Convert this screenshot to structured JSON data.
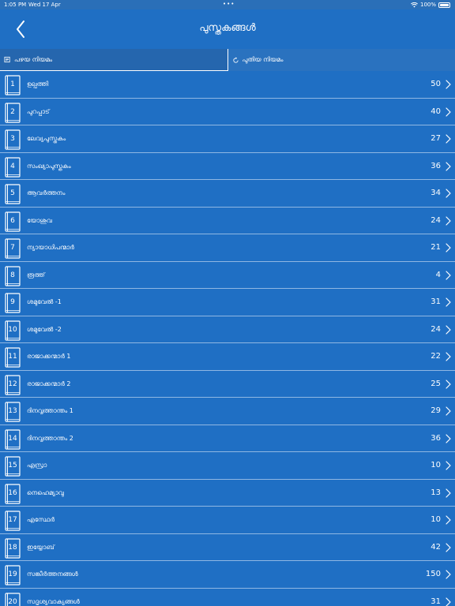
{
  "status": {
    "time": "1:05 PM",
    "date": "Wed 17 Apr",
    "dots": "•••",
    "battery": "100%"
  },
  "nav": {
    "title": "പുസ്തകങ്ങൾ",
    "back_icon": "chevron-left-icon"
  },
  "tabs": [
    {
      "label": "പഴയ നിയമം",
      "icon": "scroll-icon"
    },
    {
      "label": "പുതിയ നിയമം",
      "icon": "refresh-icon"
    }
  ],
  "books": [
    {
      "number": "1",
      "name": "ഉല്പത്തി",
      "chapters": "50"
    },
    {
      "number": "2",
      "name": "പുറപ്പാട്",
      "chapters": "40"
    },
    {
      "number": "3",
      "name": "ലേവ്യപുസ്തകം",
      "chapters": "27"
    },
    {
      "number": "4",
      "name": "സംഖ്യാപുസ്തകം",
      "chapters": "36"
    },
    {
      "number": "5",
      "name": "ആവർത്തനം",
      "chapters": "34"
    },
    {
      "number": "6",
      "name": "യോശുവ",
      "chapters": "24"
    },
    {
      "number": "7",
      "name": "ന്യായാധിപന്മാർ",
      "chapters": "21"
    },
    {
      "number": "8",
      "name": "രൂത്ത്",
      "chapters": "4"
    },
    {
      "number": "9",
      "name": "ശമുവേൽ -1",
      "chapters": "31"
    },
    {
      "number": "10",
      "name": "ശമുവേൽ -2",
      "chapters": "24"
    },
    {
      "number": "11",
      "name": "രാജാക്കന്മാർ 1",
      "chapters": "22"
    },
    {
      "number": "12",
      "name": "രാജാക്കന്മാർ 2",
      "chapters": "25"
    },
    {
      "number": "13",
      "name": "ദിനവൃത്താന്തം 1",
      "chapters": "29"
    },
    {
      "number": "14",
      "name": "ദിനവൃത്താന്തം 2",
      "chapters": "36"
    },
    {
      "number": "15",
      "name": "എസ്രാ",
      "chapters": "10"
    },
    {
      "number": "16",
      "name": "നെഹെമ്യാവു",
      "chapters": "13"
    },
    {
      "number": "17",
      "name": "എസ്ഥേർ",
      "chapters": "10"
    },
    {
      "number": "18",
      "name": "ഇയ്യോബ്",
      "chapters": "42"
    },
    {
      "number": "19",
      "name": "സങ്കീർത്തനങ്ങൾ",
      "chapters": "150"
    },
    {
      "number": "20",
      "name": "സദൃശ്യവാക്യങ്ങൾ",
      "chapters": "31"
    }
  ],
  "colors": {
    "background": "#1f6fc4",
    "separator": "#8fb7e3",
    "text": "#ffffff"
  }
}
